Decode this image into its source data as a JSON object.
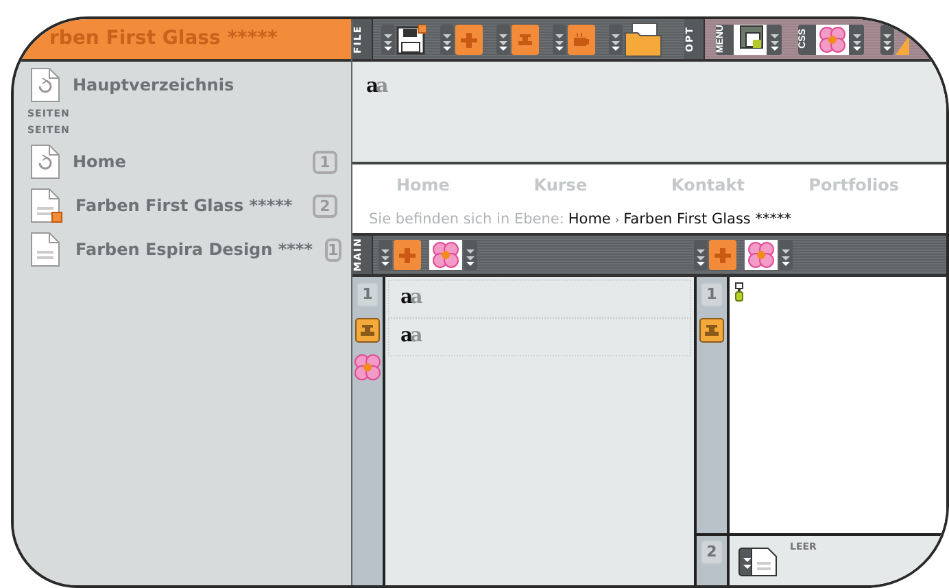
{
  "sidebar": {
    "header": "rben First Glass *****",
    "root": {
      "label": "Hauptverzeichnis"
    },
    "section_labels": [
      "SEITEN",
      "SEITEN"
    ],
    "pages": [
      {
        "label": "Home",
        "count": "1",
        "marked": false
      },
      {
        "label": "Farben First Glass *****",
        "count": "2",
        "marked": true
      },
      {
        "label": "Farben Espira Design ****",
        "count": "1",
        "marked": false
      }
    ]
  },
  "toolbar": {
    "file_label": "FILE",
    "file_tools": [
      {
        "kind": "save"
      },
      {
        "kind": "add"
      },
      {
        "kind": "tool"
      },
      {
        "kind": "cup"
      },
      {
        "kind": "folder"
      }
    ],
    "opt_label": "OPT",
    "opt_tools": [
      {
        "kind": "menu",
        "label": "MENU"
      },
      {
        "kind": "css",
        "label": "CSS"
      },
      {
        "kind": "more"
      }
    ]
  },
  "header_area": {
    "text_strong": "a",
    "text_faint": "a"
  },
  "nav": [
    "Home",
    "Kurse",
    "Kontakt",
    "Portfolios"
  ],
  "breadcrumb": {
    "prefix": "Sie befinden sich in Ebene:",
    "path": [
      "Home",
      "Farben First Glass *****"
    ],
    "separator": "›"
  },
  "main": {
    "label": "MAIN",
    "columns": [
      {
        "tools": [
          {
            "kind": "add"
          },
          {
            "kind": "flower"
          }
        ],
        "number": "1",
        "gutter_icons": [
          {
            "kind": "tool"
          },
          {
            "kind": "flower"
          }
        ],
        "blocks": [
          {
            "kind": "text",
            "strong": "a",
            "faint": "a"
          },
          {
            "kind": "text",
            "strong": "a",
            "faint": "a"
          }
        ]
      },
      {
        "tools": [
          {
            "kind": "add"
          },
          {
            "kind": "flower"
          }
        ],
        "number": "1",
        "gutter_icons": [
          {
            "kind": "tool"
          }
        ],
        "blocks": [
          {
            "kind": "pin"
          }
        ],
        "footer": {
          "number": "2",
          "label": "LEER"
        }
      }
    ]
  }
}
